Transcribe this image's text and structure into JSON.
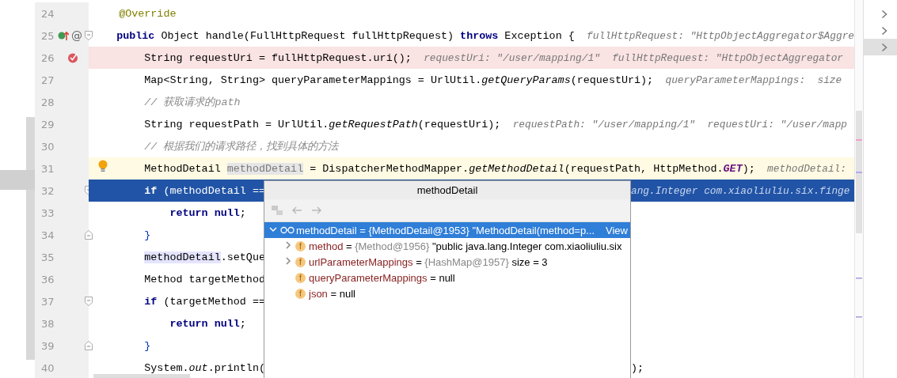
{
  "editor": {
    "lines": [
      {
        "number": "24",
        "kind": "member",
        "breakpoint": false,
        "current": false,
        "execution": false,
        "fold_start": false,
        "fold_end": false,
        "tokens": [
          {
            "kind": "annotation",
            "text": "@Override"
          }
        ]
      },
      {
        "number": "25",
        "kind": "member",
        "breakpoint": false,
        "current": false,
        "execution": false,
        "fold_start": true,
        "fold_end": false,
        "icons": [
          {
            "kind": "override"
          },
          {
            "kind": "glyph",
            "text": "@"
          }
        ],
        "tokens": [
          {
            "kind": "keyword",
            "text": "public"
          },
          {
            "kind": "plain",
            "text": " Object handle(FullHttpRequest fullHttpRequest) "
          },
          {
            "kind": "keyword",
            "text": "throws"
          },
          {
            "kind": "plain",
            "text": " Exception {"
          }
        ],
        "hints": [
          "fullHttpRequest: \"HttpObjectAggregator$Aggre"
        ]
      },
      {
        "number": "26",
        "kind": "statement",
        "breakpoint": true,
        "current": false,
        "execution": false,
        "fold_start": false,
        "fold_end": false,
        "icons": [
          {
            "kind": "breakpoint"
          }
        ],
        "tokens": [
          {
            "kind": "plain",
            "text": "String requestUri = fullHttpRequest.uri();"
          }
        ],
        "hints": [
          "requestUri: \"/user/mapping/1\"",
          "fullHttpRequest: \"HttpObjectAggregator"
        ]
      },
      {
        "number": "27",
        "kind": "statement",
        "breakpoint": false,
        "current": false,
        "execution": false,
        "fold_start": false,
        "fold_end": false,
        "tokens": [
          {
            "kind": "plain",
            "text": "Map<String, String> queryParameterMappings = UrlUtil."
          },
          {
            "kind": "static",
            "text": "getQueryParams"
          },
          {
            "kind": "plain",
            "text": "(requestUri);"
          }
        ],
        "hints": [
          "queryParameterMappings:  size"
        ]
      },
      {
        "number": "28",
        "kind": "statement",
        "breakpoint": false,
        "current": false,
        "execution": false,
        "fold_start": false,
        "fold_end": false,
        "tokens": [
          {
            "kind": "comment",
            "text": "// 获取请求的path"
          }
        ]
      },
      {
        "number": "29",
        "kind": "statement",
        "breakpoint": false,
        "current": false,
        "execution": false,
        "fold_start": false,
        "fold_end": false,
        "tokens": [
          {
            "kind": "plain",
            "text": "String requestPath = UrlUtil."
          },
          {
            "kind": "static",
            "text": "getRequestPath"
          },
          {
            "kind": "plain",
            "text": "(requestUri);"
          }
        ],
        "hints": [
          "requestPath: \"/user/mapping/1\"",
          "requestUri: \"/user/mapp"
        ]
      },
      {
        "number": "30",
        "kind": "statement",
        "breakpoint": false,
        "current": false,
        "execution": false,
        "fold_start": false,
        "fold_end": false,
        "tokens": [
          {
            "kind": "comment",
            "text": "// 根据我们的请求路径，找到具体的方法"
          }
        ]
      },
      {
        "number": "31",
        "kind": "statement",
        "breakpoint": false,
        "current": true,
        "execution": false,
        "fold_start": false,
        "fold_end": false,
        "icons": [
          {
            "kind": "bulb"
          }
        ],
        "tokens": [
          {
            "kind": "plain",
            "text": "MethodDetail "
          },
          {
            "kind": "ghost",
            "text": "methodDetail"
          },
          {
            "kind": "plain",
            "text": " = DispatcherMethodMapper."
          },
          {
            "kind": "static",
            "text": "getMethodDetail"
          },
          {
            "kind": "plain",
            "text": "(requestPath, HttpMethod."
          },
          {
            "kind": "constant",
            "text": "GET"
          },
          {
            "kind": "plain",
            "text": ");"
          }
        ],
        "hints": [
          "methodDetail:"
        ]
      },
      {
        "number": "32",
        "kind": "statement",
        "breakpoint": false,
        "current": false,
        "execution": true,
        "fold_start": true,
        "fold_end": false,
        "tokens": [
          {
            "kind": "keyword",
            "text": "if"
          },
          {
            "kind": "plain",
            "text": " (methodDetail =="
          }
        ],
        "tail": [
          {
            "kind": "hint",
            "text": "ang.Integer com.xiaoliuliu.six.finge"
          }
        ]
      },
      {
        "number": "33",
        "kind": "nested",
        "breakpoint": false,
        "current": false,
        "execution": false,
        "fold_start": false,
        "fold_end": false,
        "tokens": [
          {
            "kind": "keyword",
            "text": "return null"
          },
          {
            "kind": "plain",
            "text": ";"
          }
        ]
      },
      {
        "number": "34",
        "kind": "statement",
        "breakpoint": false,
        "current": false,
        "execution": false,
        "fold_start": false,
        "fold_end": true,
        "tokens": [
          {
            "kind": "brace",
            "text": "}"
          }
        ]
      },
      {
        "number": "35",
        "kind": "statement",
        "breakpoint": false,
        "current": false,
        "execution": false,
        "fold_start": false,
        "fold_end": false,
        "tokens": [
          {
            "kind": "usage",
            "text": "methodDetail"
          },
          {
            "kind": "plain",
            "text": ".setQue"
          }
        ]
      },
      {
        "number": "36",
        "kind": "statement",
        "breakpoint": false,
        "current": false,
        "execution": false,
        "fold_start": false,
        "fold_end": false,
        "tokens": [
          {
            "kind": "plain",
            "text": "Method targetMethod"
          }
        ]
      },
      {
        "number": "37",
        "kind": "statement",
        "breakpoint": false,
        "current": false,
        "execution": false,
        "fold_start": true,
        "fold_end": false,
        "tokens": [
          {
            "kind": "keyword",
            "text": "if"
          },
          {
            "kind": "plain",
            "text": " (targetMethod =="
          }
        ]
      },
      {
        "number": "38",
        "kind": "nested",
        "breakpoint": false,
        "current": false,
        "execution": false,
        "fold_start": false,
        "fold_end": false,
        "tokens": [
          {
            "kind": "keyword",
            "text": "return null"
          },
          {
            "kind": "plain",
            "text": ";"
          }
        ]
      },
      {
        "number": "39",
        "kind": "statement",
        "breakpoint": false,
        "current": false,
        "execution": false,
        "fold_start": false,
        "fold_end": true,
        "tokens": [
          {
            "kind": "brace",
            "text": "}"
          }
        ]
      },
      {
        "number": "40",
        "kind": "statement",
        "breakpoint": false,
        "current": false,
        "execution": false,
        "fold_start": false,
        "fold_end": false,
        "tokens": [
          {
            "kind": "plain",
            "text": "System."
          },
          {
            "kind": "static",
            "text": "out"
          },
          {
            "kind": "plain",
            "text": ".println("
          }
        ],
        "tail": [
          {
            "kind": "plain",
            "text": ");"
          }
        ]
      }
    ]
  },
  "popup": {
    "title": "methodDetail",
    "toolbar": [
      {
        "kind": "tree",
        "disabled": true
      },
      {
        "kind": "back",
        "disabled": true
      },
      {
        "kind": "forward",
        "disabled": true
      }
    ],
    "tree": [
      {
        "name": "methodDetail",
        "separator": "=",
        "type": "{MethodDetail@1953}",
        "value": "\"MethodDetail(method=p...",
        "link": "View",
        "kind": "watch",
        "selected": true,
        "expandable": true,
        "expanded": true,
        "children": [
          {
            "name": "method",
            "separator": "=",
            "type": "{Method@1956}",
            "value": "\"public java.lang.Integer com.xiaoliuliu.six",
            "badge": "f",
            "selected": false,
            "expandable": true,
            "expanded": false
          },
          {
            "name": "urlParameterMappings",
            "separator": "=",
            "type": "{HashMap@1957}",
            "value": "size = 3",
            "badge": "f",
            "selected": false,
            "expandable": true,
            "expanded": false
          },
          {
            "name": "queryParameterMappings",
            "separator": "=",
            "value": "null",
            "badge": "f",
            "selected": false,
            "expandable": false
          },
          {
            "name": "json",
            "separator": "=",
            "value": "null",
            "badge": "f",
            "selected": false,
            "expandable": false
          }
        ]
      }
    ]
  },
  "side_panel": {
    "rows": [
      {
        "selected": false
      },
      {
        "selected": false
      },
      {
        "selected": true
      }
    ]
  }
}
